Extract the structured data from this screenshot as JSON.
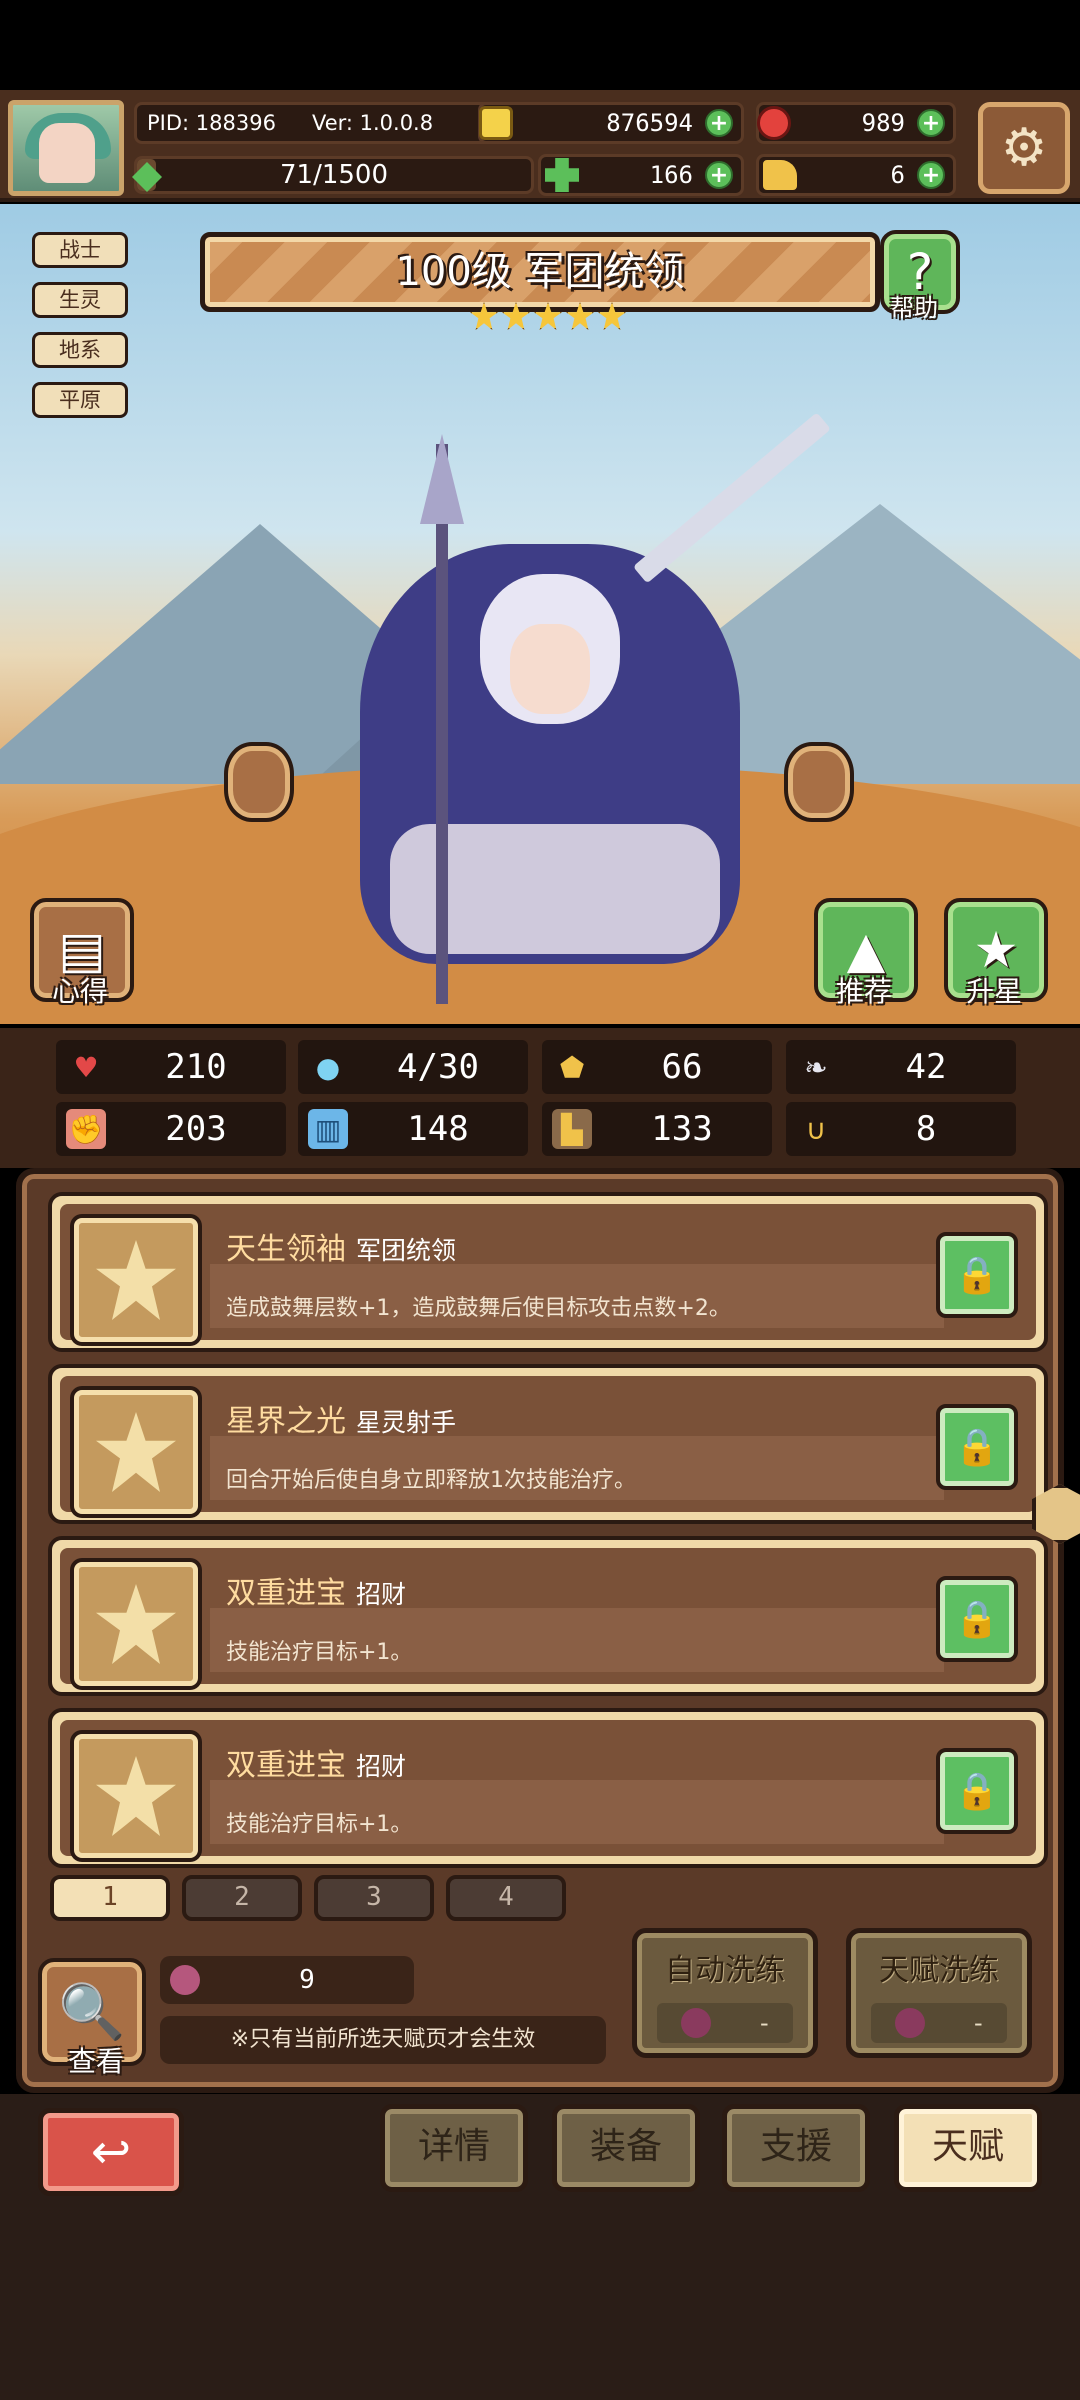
{
  "header": {
    "pid": "PID: 188396",
    "version": "Ver: 1.0.0.8",
    "gold": "876594",
    "gems": "989",
    "exp": "71/1500",
    "exp_fraction": 0.047,
    "clover": "166",
    "horn": "6"
  },
  "tags": [
    "战士",
    "生灵",
    "地系",
    "平原"
  ],
  "hero": {
    "title": "100级 军团统领",
    "stars": 5,
    "help_label": "帮助",
    "insight_label": "心得",
    "recommend_label": "推荐",
    "star_up_label": "升星"
  },
  "stats": {
    "hp": "210",
    "mana": "4/30",
    "armor": "66",
    "speed": "42",
    "attack": "203",
    "magic": "148",
    "steps": "133",
    "luck": "8"
  },
  "talents": [
    {
      "name": "天生领袖",
      "sub": "军团统领",
      "desc": "造成鼓舞层数+1，造成鼓舞后使目标攻击点数+2。"
    },
    {
      "name": "星界之光",
      "sub": "星灵射手",
      "desc": "回合开始后使自身立即释放1次技能治疗。"
    },
    {
      "name": "双重进宝",
      "sub": "招财",
      "desc": "技能治疗目标+1。"
    },
    {
      "name": "双重进宝",
      "sub": "招财",
      "desc": "技能治疗目标+1。"
    }
  ],
  "pages": [
    "1",
    "2",
    "3",
    "4"
  ],
  "footer": {
    "look_label": "查看",
    "item_count": "9",
    "note": "※只有当前所选天赋页才会生效",
    "auto_reset_label": "自动洗练",
    "auto_reset_cost": "-",
    "talent_reset_label": "天赋洗练",
    "talent_reset_cost": "-"
  },
  "nav": {
    "details": "详情",
    "equip": "装备",
    "support": "支援",
    "talent": "天赋"
  }
}
